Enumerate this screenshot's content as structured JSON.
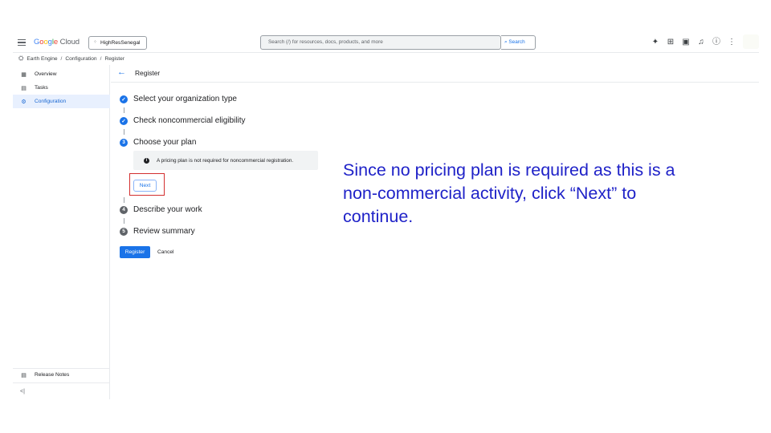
{
  "topbar": {
    "logo_google": [
      "G",
      "o",
      "o",
      "g",
      "l",
      "e"
    ],
    "logo_cloud": "Cloud",
    "project_name": "HighResSenegal",
    "search_placeholder": "Search (/) for resources, docs, products, and more",
    "search_button": "Search",
    "icons": [
      "spark-icon",
      "gift-icon",
      "terminal-icon",
      "bell-icon",
      "help-icon",
      "more-vert-icon"
    ]
  },
  "breadcrumb": [
    "Earth Engine",
    "Configuration",
    "Register"
  ],
  "sidebar": {
    "items": [
      {
        "label": "Overview",
        "icon": "grid-icon"
      },
      {
        "label": "Tasks",
        "icon": "document-icon"
      },
      {
        "label": "Configuration",
        "icon": "gear-icon",
        "active": true
      }
    ],
    "footer": {
      "label": "Release Notes",
      "icon": "notes-icon"
    },
    "collapse_label": "<|"
  },
  "page": {
    "title": "Register"
  },
  "steps": [
    {
      "number": "1",
      "label": "Select your organization type",
      "state": "done"
    },
    {
      "number": "2",
      "label": "Check noncommercial eligibility",
      "state": "done"
    },
    {
      "number": "3",
      "label": "Choose your plan",
      "state": "current"
    },
    {
      "number": "4",
      "label": "Describe your work",
      "state": "pending"
    },
    {
      "number": "5",
      "label": "Review summary",
      "state": "pending"
    }
  ],
  "plan": {
    "info_text": "A pricing plan is not required for noncommercial registration.",
    "next_label": "Next"
  },
  "actions": {
    "register_label": "Register",
    "cancel_label": "Cancel"
  },
  "annotation": {
    "text": "Since no pricing plan is required as this is a non-commercial activity, click “Next” to continue.",
    "color": "#1f22c8"
  },
  "colors": {
    "accent": "#1a73e8",
    "highlight": "#d32f2f"
  }
}
